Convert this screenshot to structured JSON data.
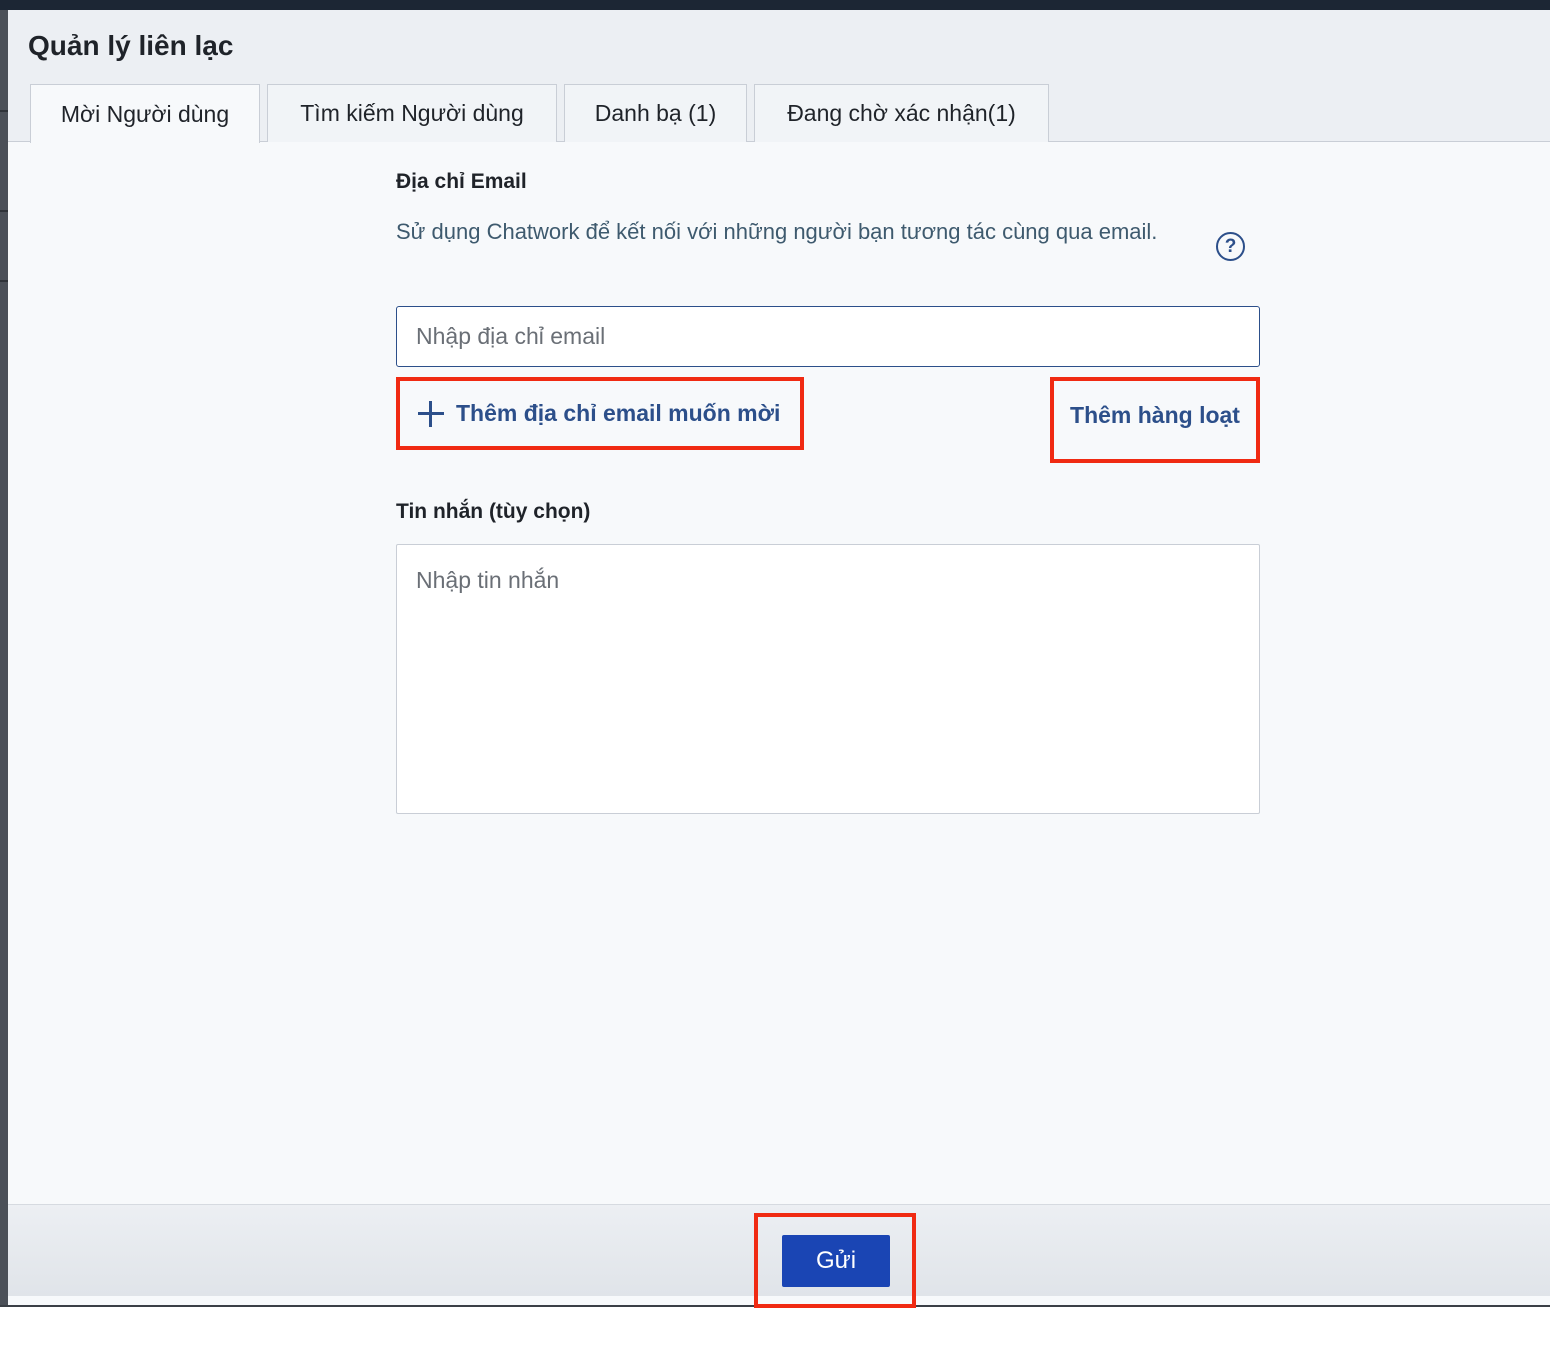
{
  "dialog": {
    "title": "Quản lý liên lạc"
  },
  "tabs": [
    {
      "label": "Mời Người dùng",
      "active": true
    },
    {
      "label": "Tìm kiếm Người dùng",
      "active": false
    },
    {
      "label": "Danh bạ (1)",
      "active": false
    },
    {
      "label": "Đang chờ xác nhận(1)",
      "active": false
    }
  ],
  "email_section": {
    "label": "Địa chỉ Email",
    "description": "Sử dụng Chatwork để kết nối với những người bạn tương tác cùng qua email.",
    "help_icon": "question-circle-icon",
    "help_glyph": "?",
    "placeholder": "Nhập địa chỉ email",
    "add_email_label": "Thêm địa chỉ email muốn mời",
    "add_icon": "plus-icon",
    "bulk_add_label": "Thêm hàng loạt"
  },
  "message_section": {
    "label": "Tin nhắn (tùy chọn)",
    "placeholder": "Nhập tin nhắn"
  },
  "footer": {
    "send_label": "Gửi"
  },
  "colors": {
    "accent": "#2c4f8a",
    "primary_button": "#1a45b4",
    "highlight_frame": "#f02a12"
  }
}
